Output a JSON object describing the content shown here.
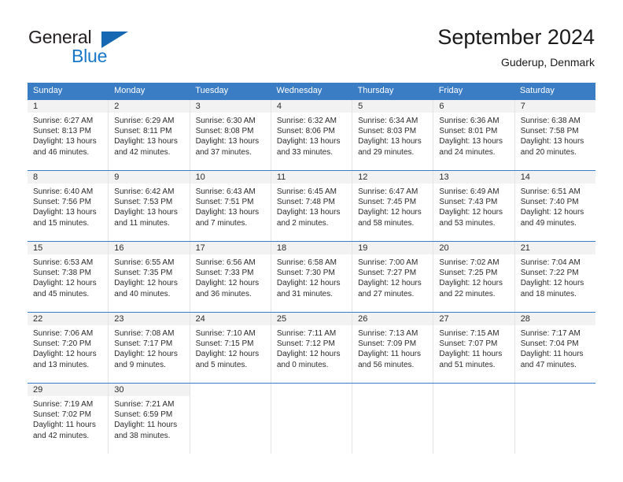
{
  "brand": {
    "name_part1": "General",
    "name_part2": "Blue",
    "triangle_icon": "blue-triangle-icon",
    "accent_color": "#1877c9"
  },
  "header": {
    "title": "September 2024",
    "subtitle": "Guderup, Denmark"
  },
  "colors": {
    "header_band": "#3b7dc4",
    "daynum_band": "#f2f2f2",
    "row_divider": "#3b7dc4",
    "column_divider": "#e4e4e4",
    "text": "#2b2b2b"
  },
  "calendar": {
    "day_headers": [
      "Sunday",
      "Monday",
      "Tuesday",
      "Wednesday",
      "Thursday",
      "Friday",
      "Saturday"
    ],
    "weeks": [
      [
        {
          "day": "1",
          "lines": [
            "Sunrise: 6:27 AM",
            "Sunset: 8:13 PM",
            "Daylight: 13 hours",
            "and 46 minutes."
          ]
        },
        {
          "day": "2",
          "lines": [
            "Sunrise: 6:29 AM",
            "Sunset: 8:11 PM",
            "Daylight: 13 hours",
            "and 42 minutes."
          ]
        },
        {
          "day": "3",
          "lines": [
            "Sunrise: 6:30 AM",
            "Sunset: 8:08 PM",
            "Daylight: 13 hours",
            "and 37 minutes."
          ]
        },
        {
          "day": "4",
          "lines": [
            "Sunrise: 6:32 AM",
            "Sunset: 8:06 PM",
            "Daylight: 13 hours",
            "and 33 minutes."
          ]
        },
        {
          "day": "5",
          "lines": [
            "Sunrise: 6:34 AM",
            "Sunset: 8:03 PM",
            "Daylight: 13 hours",
            "and 29 minutes."
          ]
        },
        {
          "day": "6",
          "lines": [
            "Sunrise: 6:36 AM",
            "Sunset: 8:01 PM",
            "Daylight: 13 hours",
            "and 24 minutes."
          ]
        },
        {
          "day": "7",
          "lines": [
            "Sunrise: 6:38 AM",
            "Sunset: 7:58 PM",
            "Daylight: 13 hours",
            "and 20 minutes."
          ]
        }
      ],
      [
        {
          "day": "8",
          "lines": [
            "Sunrise: 6:40 AM",
            "Sunset: 7:56 PM",
            "Daylight: 13 hours",
            "and 15 minutes."
          ]
        },
        {
          "day": "9",
          "lines": [
            "Sunrise: 6:42 AM",
            "Sunset: 7:53 PM",
            "Daylight: 13 hours",
            "and 11 minutes."
          ]
        },
        {
          "day": "10",
          "lines": [
            "Sunrise: 6:43 AM",
            "Sunset: 7:51 PM",
            "Daylight: 13 hours",
            "and 7 minutes."
          ]
        },
        {
          "day": "11",
          "lines": [
            "Sunrise: 6:45 AM",
            "Sunset: 7:48 PM",
            "Daylight: 13 hours",
            "and 2 minutes."
          ]
        },
        {
          "day": "12",
          "lines": [
            "Sunrise: 6:47 AM",
            "Sunset: 7:45 PM",
            "Daylight: 12 hours",
            "and 58 minutes."
          ]
        },
        {
          "day": "13",
          "lines": [
            "Sunrise: 6:49 AM",
            "Sunset: 7:43 PM",
            "Daylight: 12 hours",
            "and 53 minutes."
          ]
        },
        {
          "day": "14",
          "lines": [
            "Sunrise: 6:51 AM",
            "Sunset: 7:40 PM",
            "Daylight: 12 hours",
            "and 49 minutes."
          ]
        }
      ],
      [
        {
          "day": "15",
          "lines": [
            "Sunrise: 6:53 AM",
            "Sunset: 7:38 PM",
            "Daylight: 12 hours",
            "and 45 minutes."
          ]
        },
        {
          "day": "16",
          "lines": [
            "Sunrise: 6:55 AM",
            "Sunset: 7:35 PM",
            "Daylight: 12 hours",
            "and 40 minutes."
          ]
        },
        {
          "day": "17",
          "lines": [
            "Sunrise: 6:56 AM",
            "Sunset: 7:33 PM",
            "Daylight: 12 hours",
            "and 36 minutes."
          ]
        },
        {
          "day": "18",
          "lines": [
            "Sunrise: 6:58 AM",
            "Sunset: 7:30 PM",
            "Daylight: 12 hours",
            "and 31 minutes."
          ]
        },
        {
          "day": "19",
          "lines": [
            "Sunrise: 7:00 AM",
            "Sunset: 7:27 PM",
            "Daylight: 12 hours",
            "and 27 minutes."
          ]
        },
        {
          "day": "20",
          "lines": [
            "Sunrise: 7:02 AM",
            "Sunset: 7:25 PM",
            "Daylight: 12 hours",
            "and 22 minutes."
          ]
        },
        {
          "day": "21",
          "lines": [
            "Sunrise: 7:04 AM",
            "Sunset: 7:22 PM",
            "Daylight: 12 hours",
            "and 18 minutes."
          ]
        }
      ],
      [
        {
          "day": "22",
          "lines": [
            "Sunrise: 7:06 AM",
            "Sunset: 7:20 PM",
            "Daylight: 12 hours",
            "and 13 minutes."
          ]
        },
        {
          "day": "23",
          "lines": [
            "Sunrise: 7:08 AM",
            "Sunset: 7:17 PM",
            "Daylight: 12 hours",
            "and 9 minutes."
          ]
        },
        {
          "day": "24",
          "lines": [
            "Sunrise: 7:10 AM",
            "Sunset: 7:15 PM",
            "Daylight: 12 hours",
            "and 5 minutes."
          ]
        },
        {
          "day": "25",
          "lines": [
            "Sunrise: 7:11 AM",
            "Sunset: 7:12 PM",
            "Daylight: 12 hours",
            "and 0 minutes."
          ]
        },
        {
          "day": "26",
          "lines": [
            "Sunrise: 7:13 AM",
            "Sunset: 7:09 PM",
            "Daylight: 11 hours",
            "and 56 minutes."
          ]
        },
        {
          "day": "27",
          "lines": [
            "Sunrise: 7:15 AM",
            "Sunset: 7:07 PM",
            "Daylight: 11 hours",
            "and 51 minutes."
          ]
        },
        {
          "day": "28",
          "lines": [
            "Sunrise: 7:17 AM",
            "Sunset: 7:04 PM",
            "Daylight: 11 hours",
            "and 47 minutes."
          ]
        }
      ],
      [
        {
          "day": "29",
          "lines": [
            "Sunrise: 7:19 AM",
            "Sunset: 7:02 PM",
            "Daylight: 11 hours",
            "and 42 minutes."
          ]
        },
        {
          "day": "30",
          "lines": [
            "Sunrise: 7:21 AM",
            "Sunset: 6:59 PM",
            "Daylight: 11 hours",
            "and 38 minutes."
          ]
        },
        {
          "day": "",
          "lines": []
        },
        {
          "day": "",
          "lines": []
        },
        {
          "day": "",
          "lines": []
        },
        {
          "day": "",
          "lines": []
        },
        {
          "day": "",
          "lines": []
        }
      ]
    ]
  }
}
